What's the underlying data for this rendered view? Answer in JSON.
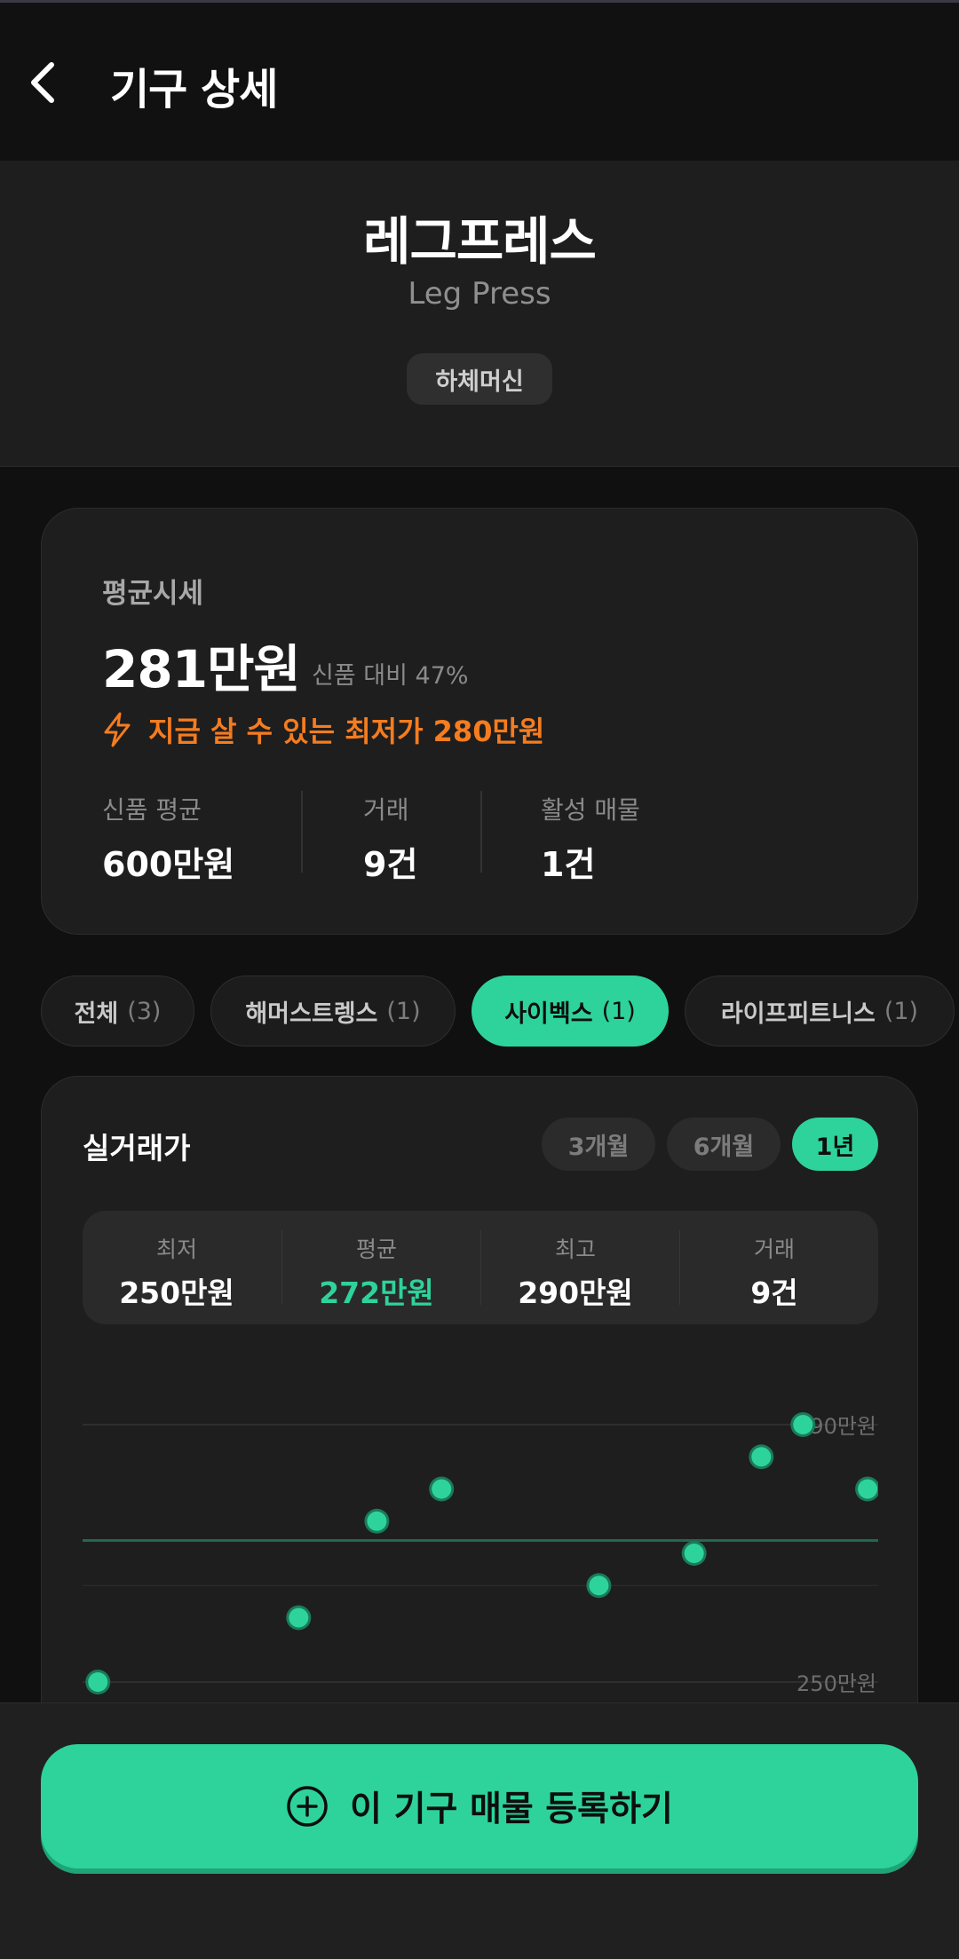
{
  "header": {
    "title": "기구 상세"
  },
  "equipment": {
    "name_ko": "레그프레스",
    "name_en": "Leg Press",
    "category": "하체머신"
  },
  "price_card": {
    "label": "평균시세",
    "average_price": "281만원",
    "ratio_text": "신품 대비 47%",
    "lowest_now": "지금 살 수 있는 최저가 280만원",
    "stats": [
      {
        "label": "신품 평균",
        "value": "600만원"
      },
      {
        "label": "거래",
        "value": "9건"
      },
      {
        "label": "활성 매물",
        "value": "1건"
      }
    ]
  },
  "brand_filters": [
    {
      "label": "전체",
      "count": "(3)",
      "active": false
    },
    {
      "label": "해머스트렝스",
      "count": "(1)",
      "active": false
    },
    {
      "label": "사이벡스",
      "count": "(1)",
      "active": true
    },
    {
      "label": "라이프피트니스",
      "count": "(1)",
      "active": false
    }
  ],
  "trade": {
    "title": "실거래가",
    "periods": [
      {
        "label": "3개월",
        "active": false
      },
      {
        "label": "6개월",
        "active": false
      },
      {
        "label": "1년",
        "active": true
      }
    ],
    "summary": [
      {
        "label": "최저",
        "value": "250만원"
      },
      {
        "label": "평균",
        "value": "272만원"
      },
      {
        "label": "최고",
        "value": "290만원"
      },
      {
        "label": "거래",
        "value": "9건"
      }
    ]
  },
  "chart_data": {
    "type": "scatter",
    "y_unit": "만원",
    "ylim": [
      250,
      290
    ],
    "y_tick_labels": [
      "290만원",
      "250만원"
    ],
    "average_line": 272,
    "points": [
      {
        "index": 1,
        "value": 250
      },
      {
        "index": 2,
        "value": 260
      },
      {
        "index": 3,
        "value": 275
      },
      {
        "index": 4,
        "value": 280
      },
      {
        "index": 5,
        "value": 265
      },
      {
        "index": 6,
        "value": 270
      },
      {
        "index": 7,
        "value": 285
      },
      {
        "index": 8,
        "value": 290
      },
      {
        "index": 9,
        "value": 280
      }
    ],
    "colors": {
      "point": "#2ed39b",
      "average_line": "#1f6a4f",
      "grid": "#2e2e2e"
    }
  },
  "cta": {
    "label": "이 기구 매물 등록하기"
  },
  "colors": {
    "accent": "#2ed39b",
    "warning": "#f57c1f",
    "background": "#101010",
    "card": "#1e1e1e"
  }
}
